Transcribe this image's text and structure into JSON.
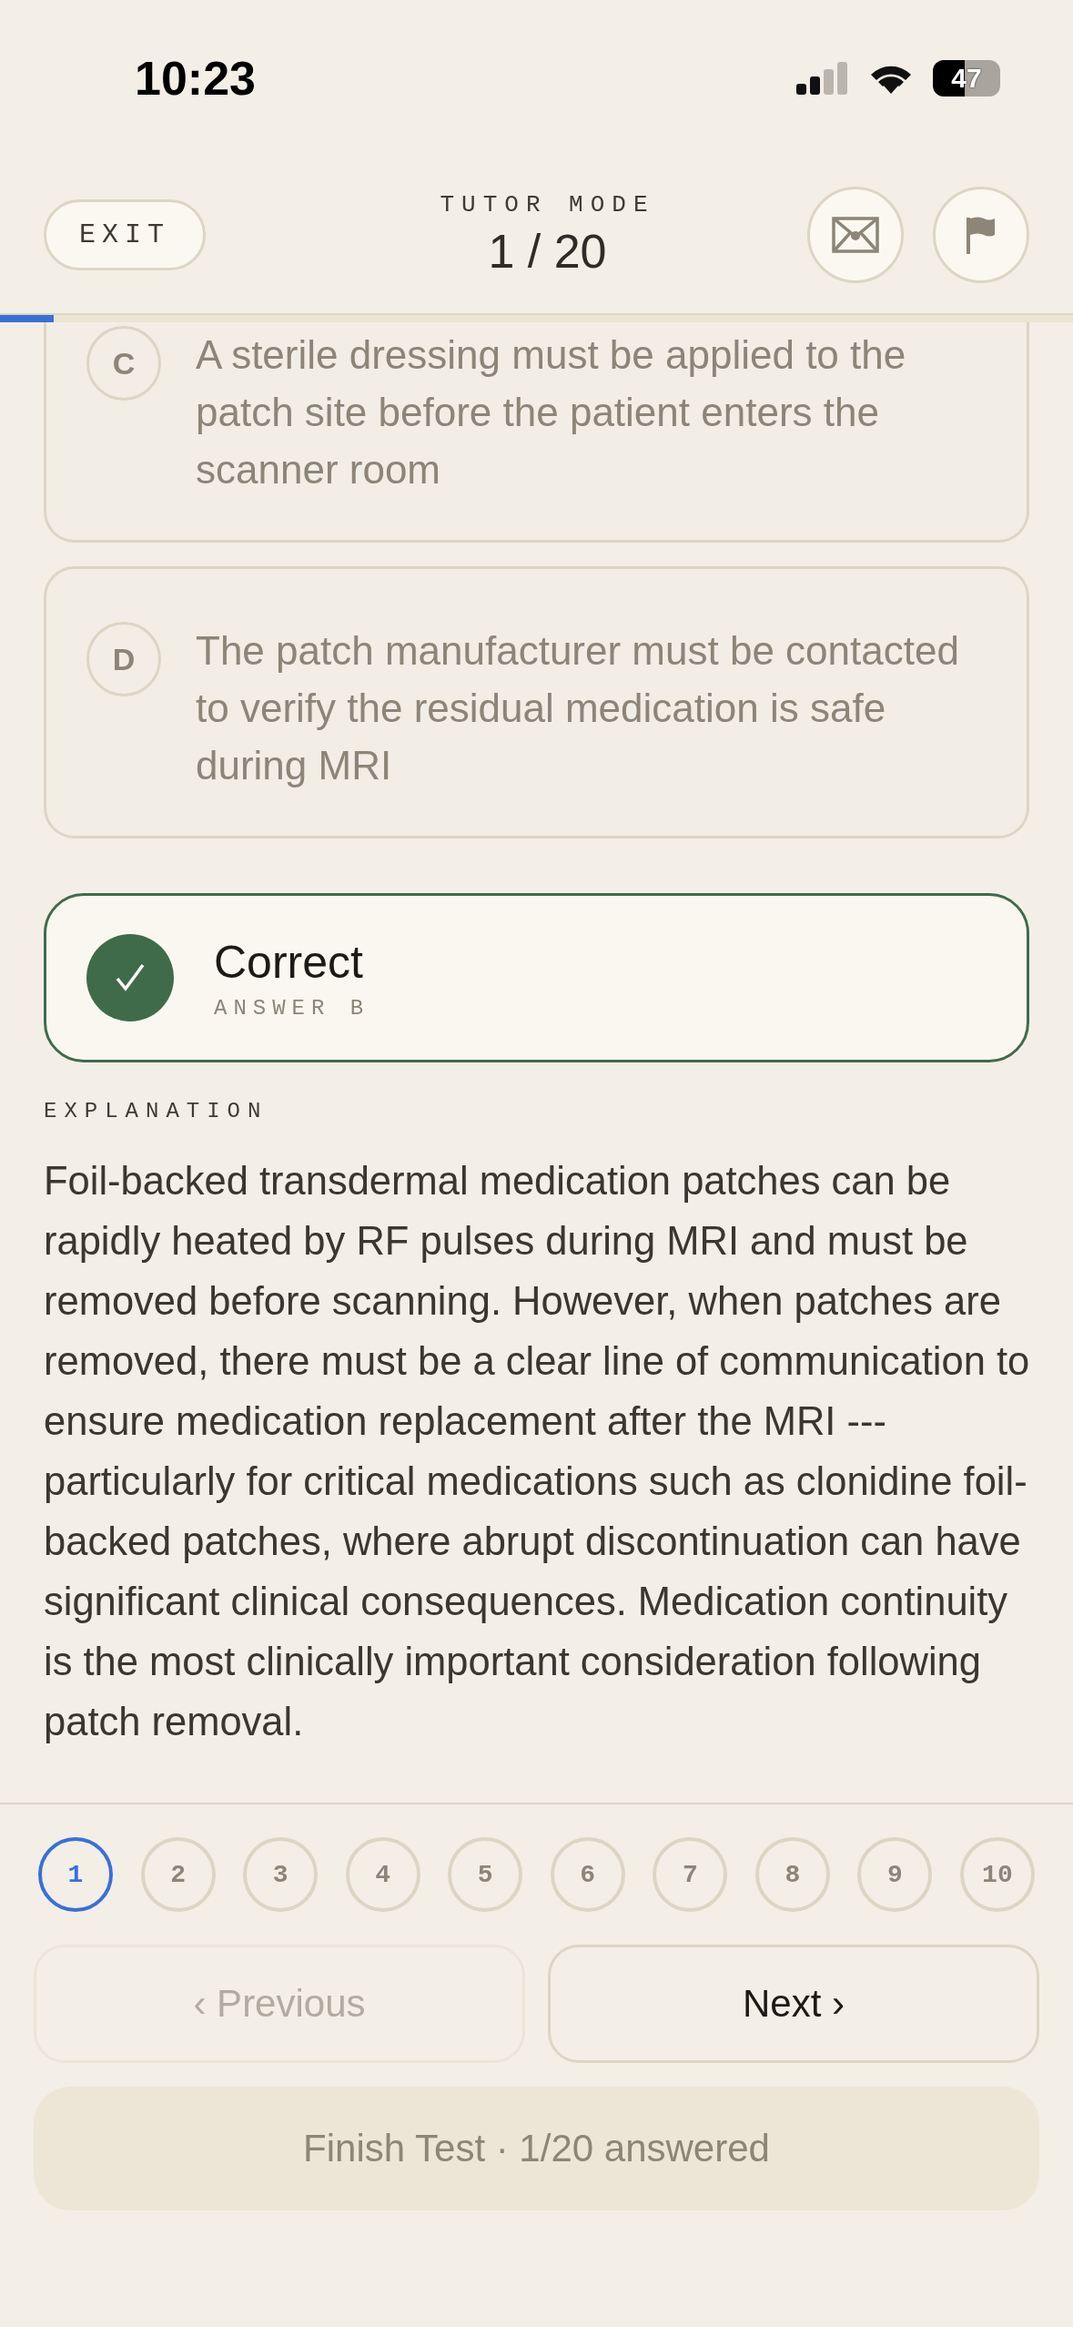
{
  "status_bar": {
    "time": "10:23",
    "battery": "47"
  },
  "header": {
    "exit": "EXIT",
    "mode": "TUTOR MODE",
    "counter": "1 / 20"
  },
  "progress": {
    "level": 0.05
  },
  "options": [
    {
      "kind": "cut",
      "letter": "C",
      "text": "A sterile dressing must be applied to the patch site before the patient enters the scanner room",
      "selected": false
    },
    {
      "kind": "full",
      "letter": "D",
      "text": "The patch manufacturer must be contacted to verify the residual medication is safe during MRI",
      "selected": false
    }
  ],
  "result": {
    "correct": true,
    "title": "Correct",
    "answer": "ANSWER B"
  },
  "explanation": {
    "label": "EXPLANATION",
    "text": "Foil-backed transdermal medication patches can be rapidly heated by RF pulses during MRI and must be removed before scanning. However, when patches are removed, there must be a clear line of communication to ensure medication replacement after the MRI --- particularly for critical medications such as clonidine foil-backed patches, where abrupt discontinuation can have significant clinical consequences. Medication continuity is the most clinically important consideration following patch removal."
  },
  "question_nav": [
    {
      "label": "1",
      "selected": true
    },
    {
      "label": "2",
      "selected": false
    },
    {
      "label": "3",
      "selected": false
    },
    {
      "label": "4",
      "selected": false
    },
    {
      "label": "5",
      "selected": false
    },
    {
      "label": "6",
      "selected": false
    },
    {
      "label": "7",
      "selected": false
    },
    {
      "label": "8",
      "selected": false
    },
    {
      "label": "9",
      "selected": false
    },
    {
      "label": "10",
      "selected": false
    }
  ],
  "buttons": [
    {
      "label": "‹ Previous",
      "disabled": true
    },
    {
      "label": "Next ›",
      "disabled": false
    }
  ],
  "finish": {
    "label": "Finish Test · 1/20 answered"
  }
}
